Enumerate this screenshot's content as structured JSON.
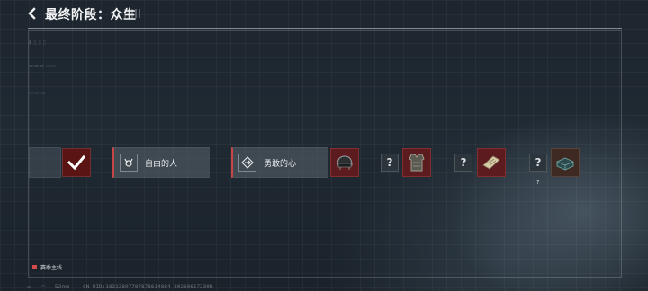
{
  "header": {
    "title": "最终阶段：众生"
  },
  "route": {
    "missions": [
      {
        "label": "自由的人"
      },
      {
        "label": "勇敢的心"
      }
    ],
    "locked_mark": "?",
    "reward_hint": "?"
  },
  "legend": {
    "label": "赛季主线",
    "color": "#d24a4a"
  },
  "status_bar": {
    "ping": "52ms",
    "uid": "CN-UID:18313897787878614884-20260617230R"
  }
}
